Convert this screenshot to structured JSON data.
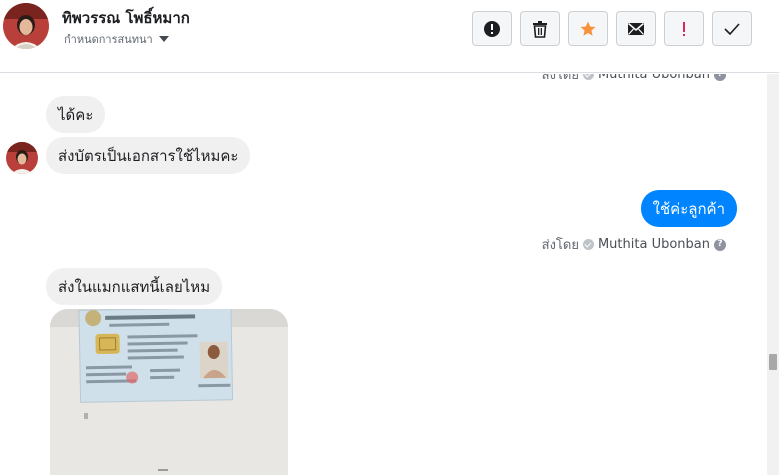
{
  "header": {
    "contact_name": "ทิพวรรณ โพธิ์หมาก",
    "conversation_settings": "กำหนดการสนทนา"
  },
  "toolbar": {
    "buttons": [
      "alert-circle-icon",
      "trash-icon",
      "star-icon",
      "envelope-icon",
      "exclamation-icon",
      "checkmark-icon"
    ],
    "star_color": "#f7923a",
    "exclamation_color": "#e0245e"
  },
  "messages": {
    "top_meta": {
      "prefix": "ส่งโดย",
      "agent": "Muthita Ubonban"
    },
    "msg1": "ได้คะ",
    "msg2": "ส่งบัตรเป็นเอกสารใช้ไหมคะ",
    "reply": "ใช้ค่ะลูกค้า",
    "reply_meta": {
      "prefix": "ส่งโดย",
      "agent": "Muthita Ubonban"
    },
    "msg3": "ส่งในแมกแสทนี้เลยไหม"
  },
  "colors": {
    "outgoing_bubble": "#0084ff",
    "incoming_bubble": "#f1f0f0"
  }
}
